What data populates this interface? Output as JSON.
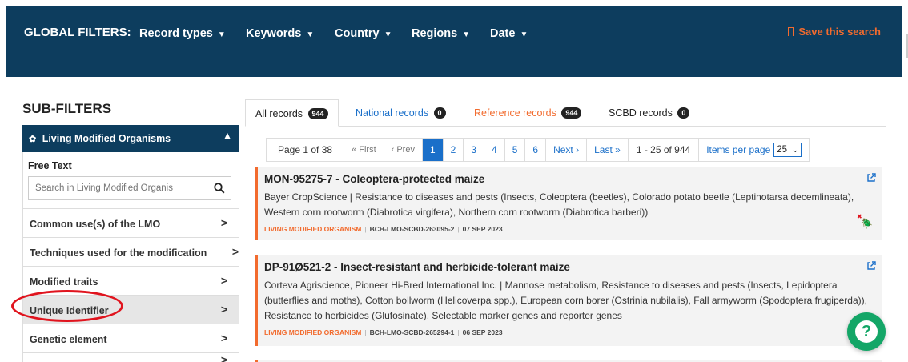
{
  "global_filters": {
    "label": "GLOBAL FILTERS:",
    "items": [
      {
        "label": "Record types",
        "caret": "▼"
      },
      {
        "label": "Keywords",
        "caret": "▼"
      },
      {
        "label": "Country",
        "caret": "▼"
      },
      {
        "label": "Regions",
        "caret": "▼"
      },
      {
        "label": "Date",
        "caret": "▼"
      }
    ],
    "save_label": "Save this search"
  },
  "sidebar": {
    "title": "SUB-FILTERS",
    "section_title": "Living Modified Organisms",
    "free_text_label": "Free Text",
    "search_placeholder": "Search in Living Modified Organis",
    "items": [
      {
        "label": "Common use(s) of the LMO"
      },
      {
        "label": "Techniques used for the modification"
      },
      {
        "label": "Modified traits"
      },
      {
        "label": "Unique Identifier"
      },
      {
        "label": "Genetic element"
      }
    ],
    "highlight_color": "#e0141e"
  },
  "tabs": [
    {
      "label": "All records",
      "count": "944"
    },
    {
      "label": "National records",
      "count": "0"
    },
    {
      "label": "Reference records",
      "count": "944"
    },
    {
      "label": "SCBD records",
      "count": "0"
    }
  ],
  "pager": {
    "page_info": "Page 1 of 38",
    "first": "« First",
    "prev": "‹ Prev",
    "pages": [
      "1",
      "2",
      "3",
      "4",
      "5",
      "6"
    ],
    "next": "Next ›",
    "last": "Last »",
    "range": "1 - 25 of 944",
    "items_per_page_label": "Items per page",
    "items_per_page_value": "25"
  },
  "records": [
    {
      "title": "MON-95275-7 - Coleoptera-protected maize",
      "description": "Bayer CropScience | Resistance to diseases and pests (Insects, Coleoptera (beetles), Colorado potato beetle (Leptinotarsa decemlineata), Western corn rootworm (Diabrotica virgifera), Northern corn rootworm (Diabrotica barberi))",
      "type": "LIVING MODIFIED ORGANISM",
      "id": "BCH-LMO-SCBD-263095-2",
      "date": "07 SEP 2023"
    },
    {
      "title": "DP-91Ø521-2 - Insect-resistant and herbicide-tolerant maize",
      "description": "Corteva Agriscience, Pioneer Hi-Bred International Inc. | Mannose metabolism, Resistance to diseases and pests (Insects, Lepidoptera (butterflies and moths), Cotton bollworm (Helicoverpa spp.), European corn borer (Ostrinia nubilalis), Fall armyworm (Spodoptera frugiperda)), Resistance to herbicides (Glufosinate), Selectable marker genes and reporter genes",
      "type": "LIVING MODIFIED ORGANISM",
      "id": "BCH-LMO-SCBD-265294-1",
      "date": "06 SEP 2023"
    }
  ],
  "colors": {
    "header_bg": "#0d3d5e",
    "accent_orange": "#f26b2e",
    "link_blue": "#1a6fc9",
    "help_green": "#13a667"
  },
  "help_icon": "question-icon"
}
